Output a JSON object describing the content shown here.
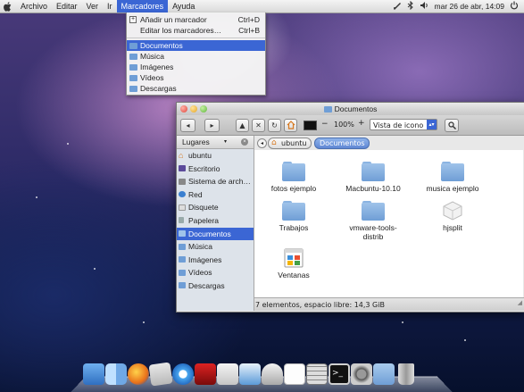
{
  "menubar": {
    "items": [
      "Archivo",
      "Editar",
      "Ver",
      "Ir",
      "Marcadores",
      "Ayuda"
    ],
    "active_index": 4,
    "clock": "mar 26 de abr, 14:09"
  },
  "bookmarks_menu": {
    "add": "Añadir un marcador",
    "add_shortcut": "Ctrl+D",
    "edit": "Editar los marcadores…",
    "edit_shortcut": "Ctrl+B",
    "places": [
      "Documentos",
      "Música",
      "Imágenes",
      "Vídeos",
      "Descargas"
    ],
    "selected_index": 0
  },
  "window": {
    "title": "Documentos",
    "zoom": "100%",
    "view_mode": "Vista de icono",
    "sidebar_title": "Lugares",
    "sidebar_items": [
      "ubuntu",
      "Escritorio",
      "Sistema de arch…",
      "Red",
      "Disquete",
      "Papelera",
      "Documentos",
      "Música",
      "Imágenes",
      "Vídeos",
      "Descargas"
    ],
    "sidebar_selected": 6,
    "path": [
      "ubuntu",
      "Documentos"
    ],
    "files": [
      {
        "name": "fotos ejemplo",
        "kind": "folder"
      },
      {
        "name": "Macbuntu-10.10",
        "kind": "folder"
      },
      {
        "name": "musica ejemplo",
        "kind": "folder"
      },
      {
        "name": "Trabajos",
        "kind": "folder"
      },
      {
        "name": "vmware-tools-distrib",
        "kind": "folder"
      },
      {
        "name": "hjsplit",
        "kind": "file"
      },
      {
        "name": "Ventanas",
        "kind": "file"
      }
    ],
    "status": "7 elementos, espacio libre: 14,3 GiB"
  },
  "colors": {
    "selection": "#3b66d4",
    "folder": "#6f9ed6"
  },
  "dock": {
    "icons": [
      "ubuntu-software-icon",
      "finder-icon",
      "firefox-icon",
      "mail-icon",
      "itunes-icon",
      "photo-booth-icon",
      "preview-icon",
      "image-viewer-icon",
      "disk-icon",
      "text-editor-icon",
      "calculator-icon",
      "terminal-icon",
      "system-settings-icon",
      "downloads-folder-icon",
      "trash-icon"
    ]
  }
}
